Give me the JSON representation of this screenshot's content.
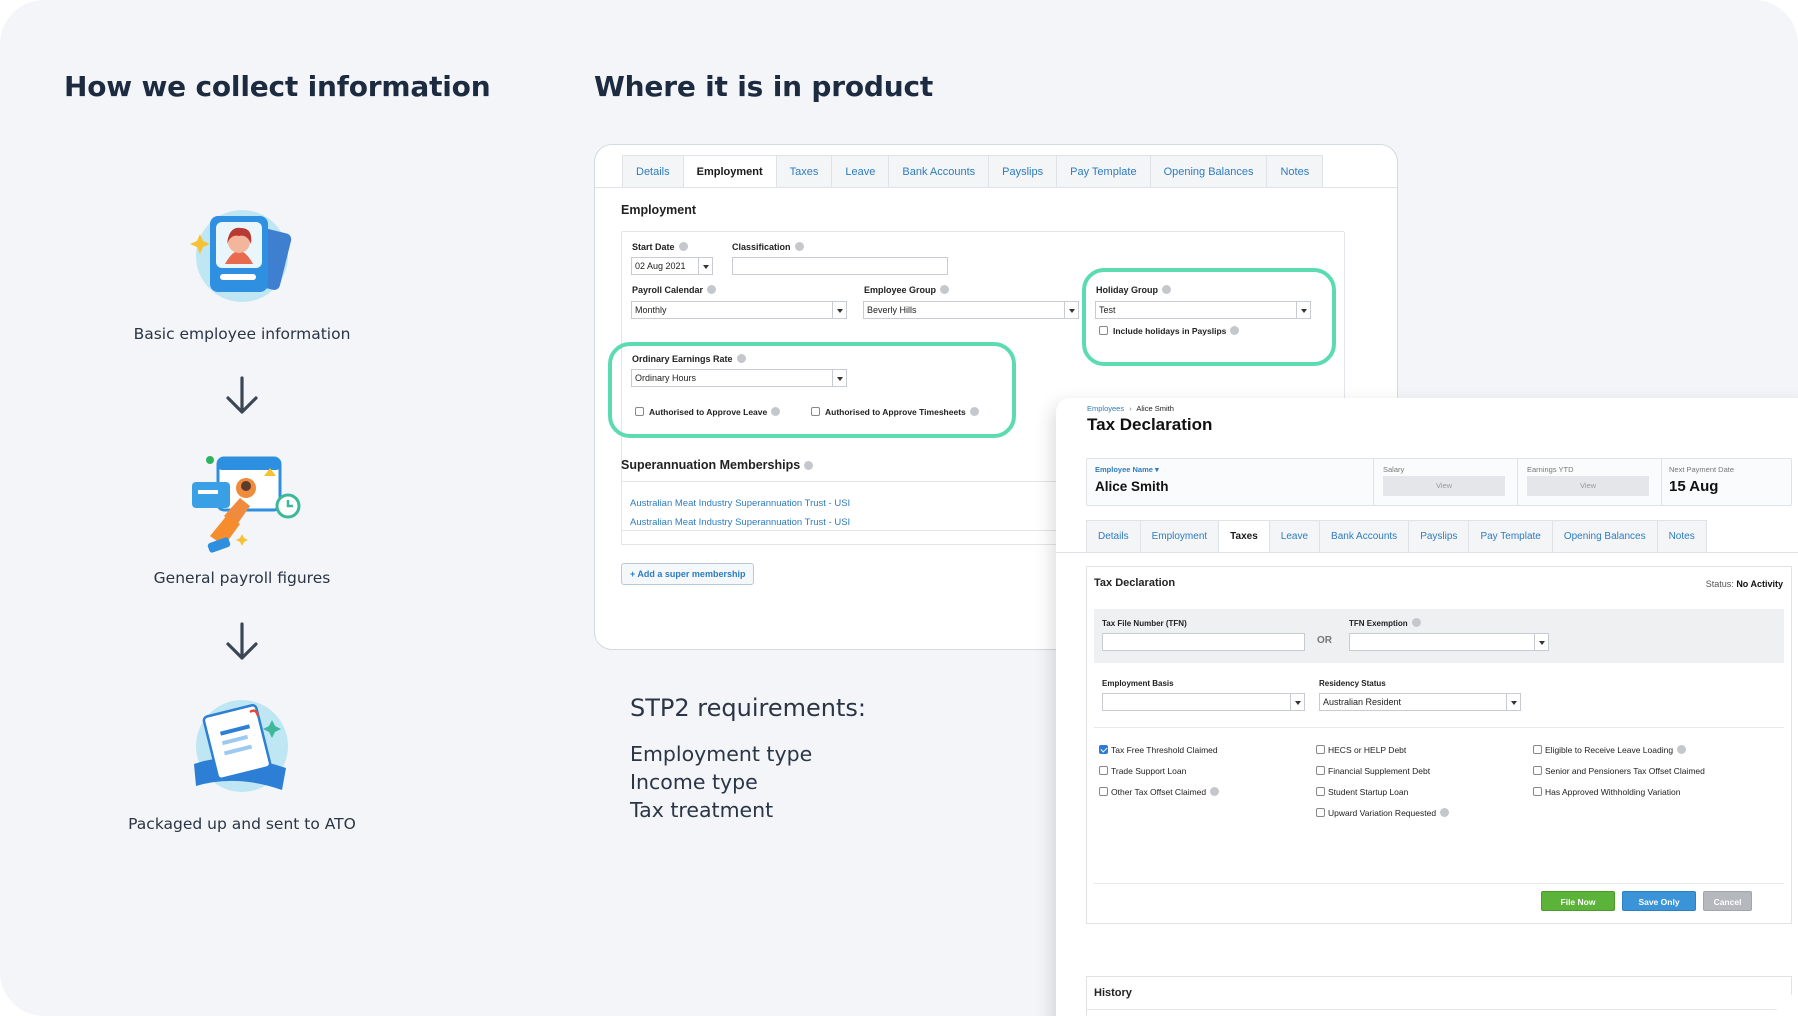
{
  "headings": {
    "left": "How we collect information",
    "right": "Where it is in product"
  },
  "steps": [
    {
      "label": "Basic employee information",
      "icon": "employee-card-illustration"
    },
    {
      "label": "General payroll figures",
      "icon": "payroll-calendar-illustration"
    },
    {
      "label": "Packaged up and sent to ATO",
      "icon": "document-package-illustration"
    }
  ],
  "stp": {
    "title": "STP2 requirements:",
    "items": [
      "Employment type",
      "Income type",
      "Tax treatment"
    ]
  },
  "employment": {
    "tabs": [
      "Details",
      "Employment",
      "Taxes",
      "Leave",
      "Bank Accounts",
      "Payslips",
      "Pay Template",
      "Opening Balances",
      "Notes"
    ],
    "active_tab": "Employment",
    "section_title": "Employment",
    "start_date_label": "Start Date",
    "start_date_value": "02 Aug 2021",
    "classification_label": "Classification",
    "classification_value": "",
    "payroll_calendar_label": "Payroll Calendar",
    "payroll_calendar_value": "Monthly",
    "employee_group_label": "Employee Group",
    "employee_group_value": "Beverly Hills",
    "holiday_group_label": "Holiday Group",
    "holiday_group_value": "Test",
    "include_holidays_label": "Include holidays in Payslips",
    "ordinary_rate_label": "Ordinary Earnings Rate",
    "ordinary_rate_value": "Ordinary Hours",
    "approve_leave_label": "Authorised to Approve Leave",
    "approve_timesheets_label": "Authorised to Approve Timesheets",
    "super_title": "Superannuation Memberships",
    "super_links": [
      "Australian Meat Industry Superannuation Trust - USI",
      "Australian Meat Industry Superannuation Trust - USI"
    ],
    "add_super_label": "+ Add a super membership"
  },
  "tax": {
    "breadcrumb_root": "Employees",
    "breadcrumb_sep": "›",
    "breadcrumb_current": "Alice Smith",
    "title": "Tax Declaration",
    "employee_name_label": "Employee Name ▾",
    "employee_name": "Alice Smith",
    "salary_label": "Salary",
    "earnings_ytd_label": "Earnings YTD",
    "view_label": "View",
    "next_payment_label": "Next Payment Date",
    "next_payment_value": "15 Aug",
    "tabs": [
      "Details",
      "Employment",
      "Taxes",
      "Leave",
      "Bank Accounts",
      "Payslips",
      "Pay Template",
      "Opening Balances",
      "Notes"
    ],
    "active_tab": "Taxes",
    "section_title": "Tax Declaration",
    "status_label": "Status:",
    "status_value": "No Activity",
    "tfn_label": "Tax File Number (TFN)",
    "or_label": "OR",
    "tfn_exemption_label": "TFN Exemption",
    "employment_basis_label": "Employment Basis",
    "residency_label": "Residency Status",
    "residency_value": "Australian Resident",
    "checkboxes": [
      {
        "label": "Tax Free Threshold Claimed",
        "checked": true
      },
      {
        "label": "Trade Support Loan",
        "checked": false
      },
      {
        "label": "Other Tax Offset Claimed",
        "checked": false
      },
      {
        "label": "HECS or HELP Debt",
        "checked": false
      },
      {
        "label": "Financial Supplement Debt",
        "checked": false
      },
      {
        "label": "Student Startup Loan",
        "checked": false
      },
      {
        "label": "Upward Variation Requested",
        "checked": false
      },
      {
        "label": "Eligible to Receive Leave Loading",
        "checked": false
      },
      {
        "label": "Senior and Pensioners Tax Offset Claimed",
        "checked": false
      },
      {
        "label": "Has Approved Withholding Variation",
        "checked": false
      }
    ],
    "file_now_label": "File Now",
    "save_only_label": "Save Only",
    "cancel_label": "Cancel",
    "history_label": "History"
  },
  "colors": {
    "highlight": "#5ddbb0",
    "link": "#2d7cc1",
    "file_now": "#5cb33a",
    "save_only": "#3c94d8",
    "cancel": "#b5b8bc"
  }
}
